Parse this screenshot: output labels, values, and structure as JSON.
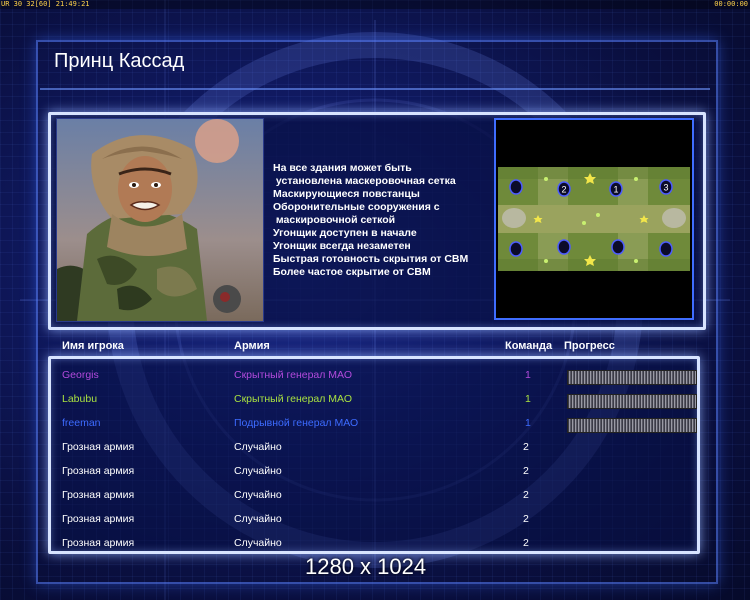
{
  "status_bar": {
    "left": "UR  30  32[60]  21:49:21",
    "right": "00:00:00"
  },
  "title": "Принц Кассад",
  "features": [
    "На все здания может быть",
    " установлена маскеровочная сетка",
    "Маскирующиеся повстанцы",
    "Оборонительные сооружения с",
    " маскировочной сеткой",
    "Угонщик доступен в начале",
    "Угонщик всегда незаметен",
    "Быстрая готовность скрытия от СВМ",
    "Более частое скрытие от СВМ"
  ],
  "minimap": {
    "spawn_numbers": [
      "2",
      "1",
      "3"
    ]
  },
  "table": {
    "headers": {
      "player": "Имя игрока",
      "army": "Армия",
      "team": "Команда",
      "progress": "Прогресс"
    },
    "rows": [
      {
        "player": "Georgis",
        "army": "Скрытный генерал МАО",
        "team": "1",
        "color": "#b24adc",
        "progress": 1.0
      },
      {
        "player": "Labubu",
        "army": "Скрытный генерал МАО",
        "team": "1",
        "color": "#a8e040",
        "progress": 1.0
      },
      {
        "player": "freeman",
        "army": "Подрывной генерал МАО",
        "team": "1",
        "color": "#3d6bff",
        "progress": 1.0
      },
      {
        "player": "Грозная армия",
        "army": "Случайно",
        "team": "2",
        "color": "#ffffff"
      },
      {
        "player": "Грозная армия",
        "army": "Случайно",
        "team": "2",
        "color": "#ffffff"
      },
      {
        "player": "Грозная армия",
        "army": "Случайно",
        "team": "2",
        "color": "#ffffff"
      },
      {
        "player": "Грозная армия",
        "army": "Случайно",
        "team": "2",
        "color": "#ffffff"
      },
      {
        "player": "Грозная армия",
        "army": "Случайно",
        "team": "2",
        "color": "#ffffff"
      }
    ]
  },
  "resolution_overlay": "1280 x 1024",
  "colors": {
    "frame_glow": "#d8e4ff",
    "accent_blue": "#3f6dff"
  }
}
